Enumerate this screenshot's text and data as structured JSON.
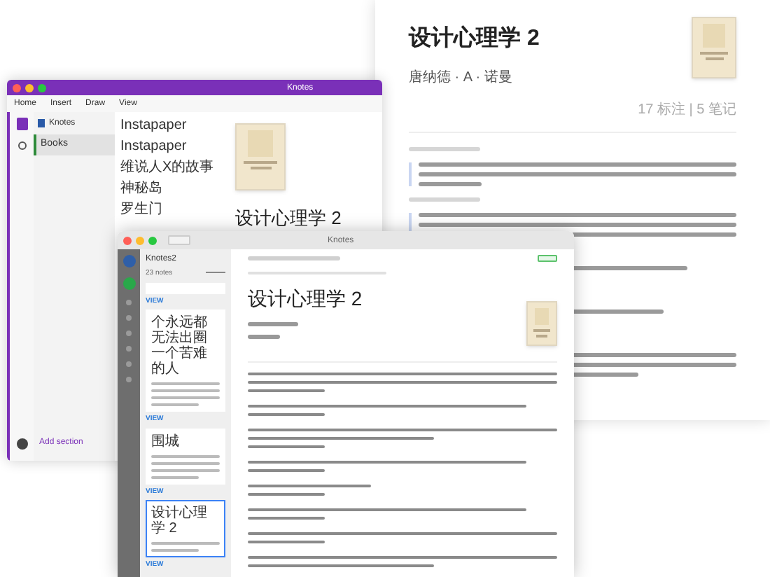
{
  "reader_window": {
    "title": "设计心理学 2",
    "author": "唐纳德 · A · 诺曼",
    "stats": "17 标注 | 5 笔记"
  },
  "onenote_window": {
    "title": "Knotes",
    "menu": [
      {
        "label": "Home",
        "selected": false
      },
      {
        "label": "Insert",
        "selected": false
      },
      {
        "label": "Draw",
        "selected": false
      },
      {
        "label": "View",
        "selected": false
      }
    ],
    "notebook": "Knotes",
    "sections": [
      {
        "label": "Books",
        "selected": true
      }
    ],
    "pages": [
      {
        "label": "Instapaper"
      },
      {
        "label": "Instapaper"
      },
      {
        "label": "维说人X的故事"
      },
      {
        "label": "神秘岛"
      },
      {
        "label": "罗生门"
      }
    ],
    "page_title": "设计心理学 2",
    "add_section": "Add section"
  },
  "knotes_window": {
    "title": "Knotes",
    "notebook": "Knotes2",
    "note_count": "23 notes",
    "link": "VIEW",
    "notes": [
      {
        "title": "个永远都无法出圈一个苦难的人",
        "link": "VIEW",
        "selected": false
      },
      {
        "title": "围城",
        "link": "VIEW",
        "selected": false
      },
      {
        "title": "设计心理学 2",
        "link": "VIEW",
        "selected": true
      }
    ],
    "book_title": "设计心理学 2"
  }
}
